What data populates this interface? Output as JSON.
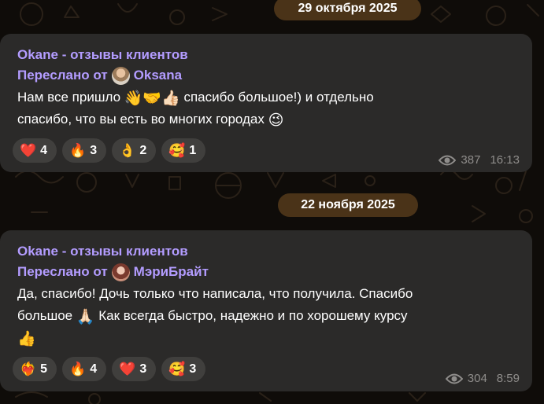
{
  "theme": {
    "accent": "#b39cff",
    "bubble": "#2b2a29",
    "date_pill": "#4a3318",
    "reaction_bg": "#403f3d",
    "meta_text": "#8f8d8b"
  },
  "dates": [
    {
      "label": "29 октября 2025"
    },
    {
      "label": "22 ноября 2025"
    }
  ],
  "messages": [
    {
      "channel": "Okane - отзывы клиентов",
      "forwarded_prefix": "Переслано от",
      "forwarded_from": "Oksana",
      "avatar_icon": "user-avatar-oksana",
      "line1_a": "Нам все пришло ",
      "line1_emoji": "👋🤝👍🏻",
      "line1_b": " спасибо большое!) и отдельно",
      "line2_a": "спасибо, что вы есть во многих городах ",
      "line2_emoji": "😉",
      "reactions": [
        {
          "emoji": "❤️",
          "count": "4"
        },
        {
          "emoji": "🔥",
          "count": "3"
        },
        {
          "emoji": "👌",
          "count": "2"
        },
        {
          "emoji": "🥰",
          "count": "1"
        }
      ],
      "views": "387",
      "time": "16:13"
    },
    {
      "channel": "Okane - отзывы клиентов",
      "forwarded_prefix": "Переслано от",
      "forwarded_from": "МэриБрайт",
      "avatar_icon": "user-avatar-meribright",
      "line1": "Да, спасибо! Дочь только что написала, что получила. Спасибо",
      "line2_a": "большое ",
      "line2_emoji": "🙏🏻",
      "line2_b": " Как всегда быстро, надежно и по хорошему курсу",
      "line3_emoji": "👍",
      "reactions": [
        {
          "emoji": "❤️‍🔥",
          "count": "5"
        },
        {
          "emoji": "🔥",
          "count": "4"
        },
        {
          "emoji": "❤️",
          "count": "3"
        },
        {
          "emoji": "🥰",
          "count": "3"
        }
      ],
      "views": "304",
      "time": "8:59"
    }
  ]
}
